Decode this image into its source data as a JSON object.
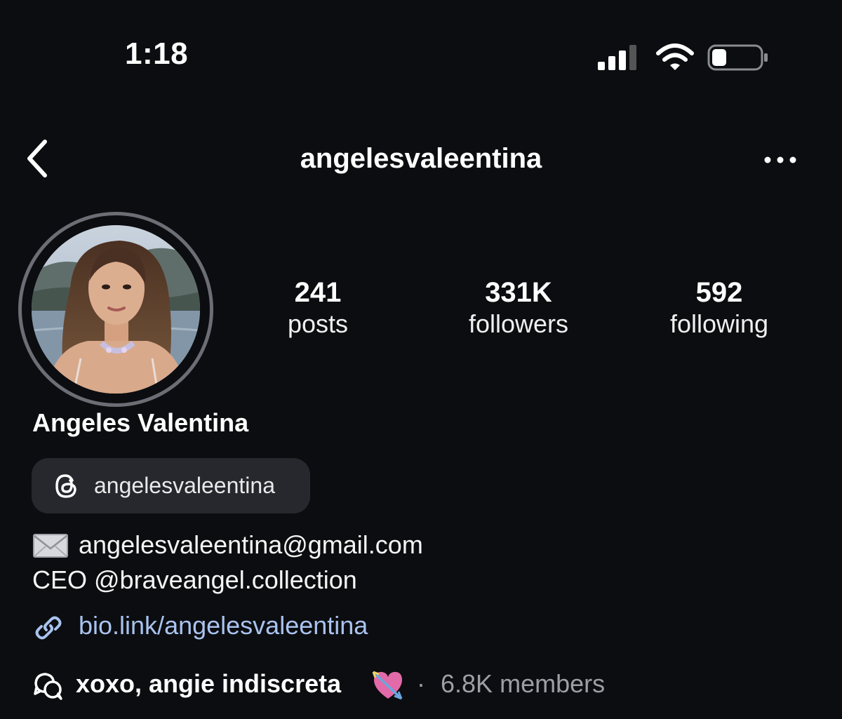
{
  "status_bar": {
    "time": "1:18"
  },
  "header": {
    "username": "angelesvaleentina"
  },
  "stats": [
    {
      "value": "241",
      "label": "posts"
    },
    {
      "value": "331K",
      "label": "followers"
    },
    {
      "value": "592",
      "label": "following"
    }
  ],
  "profile": {
    "display_name": "Angeles Valentina",
    "threads_handle": "angelesvaleentina",
    "bio": [
      "angelesvaleentina@gmail.com",
      "CEO @braveangel.collection"
    ],
    "link": "bio.link/angelesvaleentina"
  },
  "channel": {
    "name": "xoxo, angie indiscreta",
    "separator": "·",
    "members": "6.8K members"
  },
  "icons": {
    "status": [
      "signal-icon",
      "wifi-icon",
      "battery-icon"
    ],
    "header": [
      "back-chevron-icon",
      "more-options-icon"
    ],
    "profile": [
      "threads-icon",
      "envelope-icon",
      "link-icon",
      "broadcast-channel-icon",
      "heart-arrow-icon"
    ]
  },
  "colors": {
    "background": "#0c0d10",
    "pill": "#26282d",
    "link": "#a9c3ef",
    "muted": "#9c9fa5"
  }
}
